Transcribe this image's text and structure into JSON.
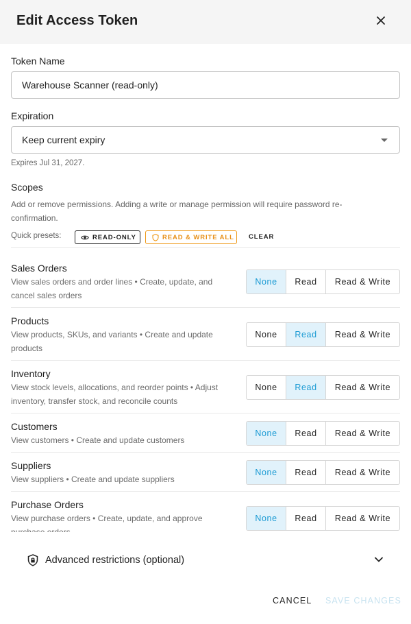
{
  "dialog": {
    "title": "Edit Access Token"
  },
  "token_name": {
    "label": "Token Name",
    "value": "Warehouse Scanner (read-only)"
  },
  "expiration": {
    "label": "Expiration",
    "selected": "Keep current expiry",
    "hint": "Expires Jul 31, 2027."
  },
  "scopes": {
    "label": "Scopes",
    "description": "Add or remove permissions. Adding a write or manage permission will require password re-confirmation.",
    "presets_label": "Quick presets:",
    "preset_read_only": "READ-ONLY",
    "preset_read_write_all": "READ & WRITE ALL",
    "clear": "CLEAR",
    "option_none": "None",
    "option_read": "Read",
    "option_read_write": "Read & Write",
    "items": [
      {
        "title": "Sales Orders",
        "description": "View sales orders and order lines • Create, update, and cancel sales orders",
        "selected": "None"
      },
      {
        "title": "Products",
        "description": "View products, SKUs, and variants • Create and update products",
        "selected": "Read"
      },
      {
        "title": "Inventory",
        "description": "View stock levels, allocations, and reorder points • Adjust inventory, transfer stock, and reconcile counts",
        "selected": "Read"
      },
      {
        "title": "Customers",
        "description": "View customers • Create and update customers",
        "selected": "None"
      },
      {
        "title": "Suppliers",
        "description": "View suppliers • Create and update suppliers",
        "selected": "None"
      },
      {
        "title": "Purchase Orders",
        "description": "View purchase orders • Create, update, and approve purchase orders",
        "selected": "None"
      }
    ]
  },
  "advanced": {
    "label": "Advanced restrictions (optional)"
  },
  "actions": {
    "cancel": "CANCEL",
    "save": "SAVE CHANGES"
  },
  "colors": {
    "accent": "#1a9ad3",
    "selected_bg": "#e1f2fb",
    "warning": "#ef9a1a",
    "header_bg": "#f5f5f5"
  },
  "icons": {
    "close": "close-icon",
    "dropdown": "caret-down-icon",
    "read_only_preset": "eye-icon",
    "read_write_preset": "shield-icon",
    "advanced": "shield-lock-icon",
    "expand": "chevron-down-icon"
  }
}
